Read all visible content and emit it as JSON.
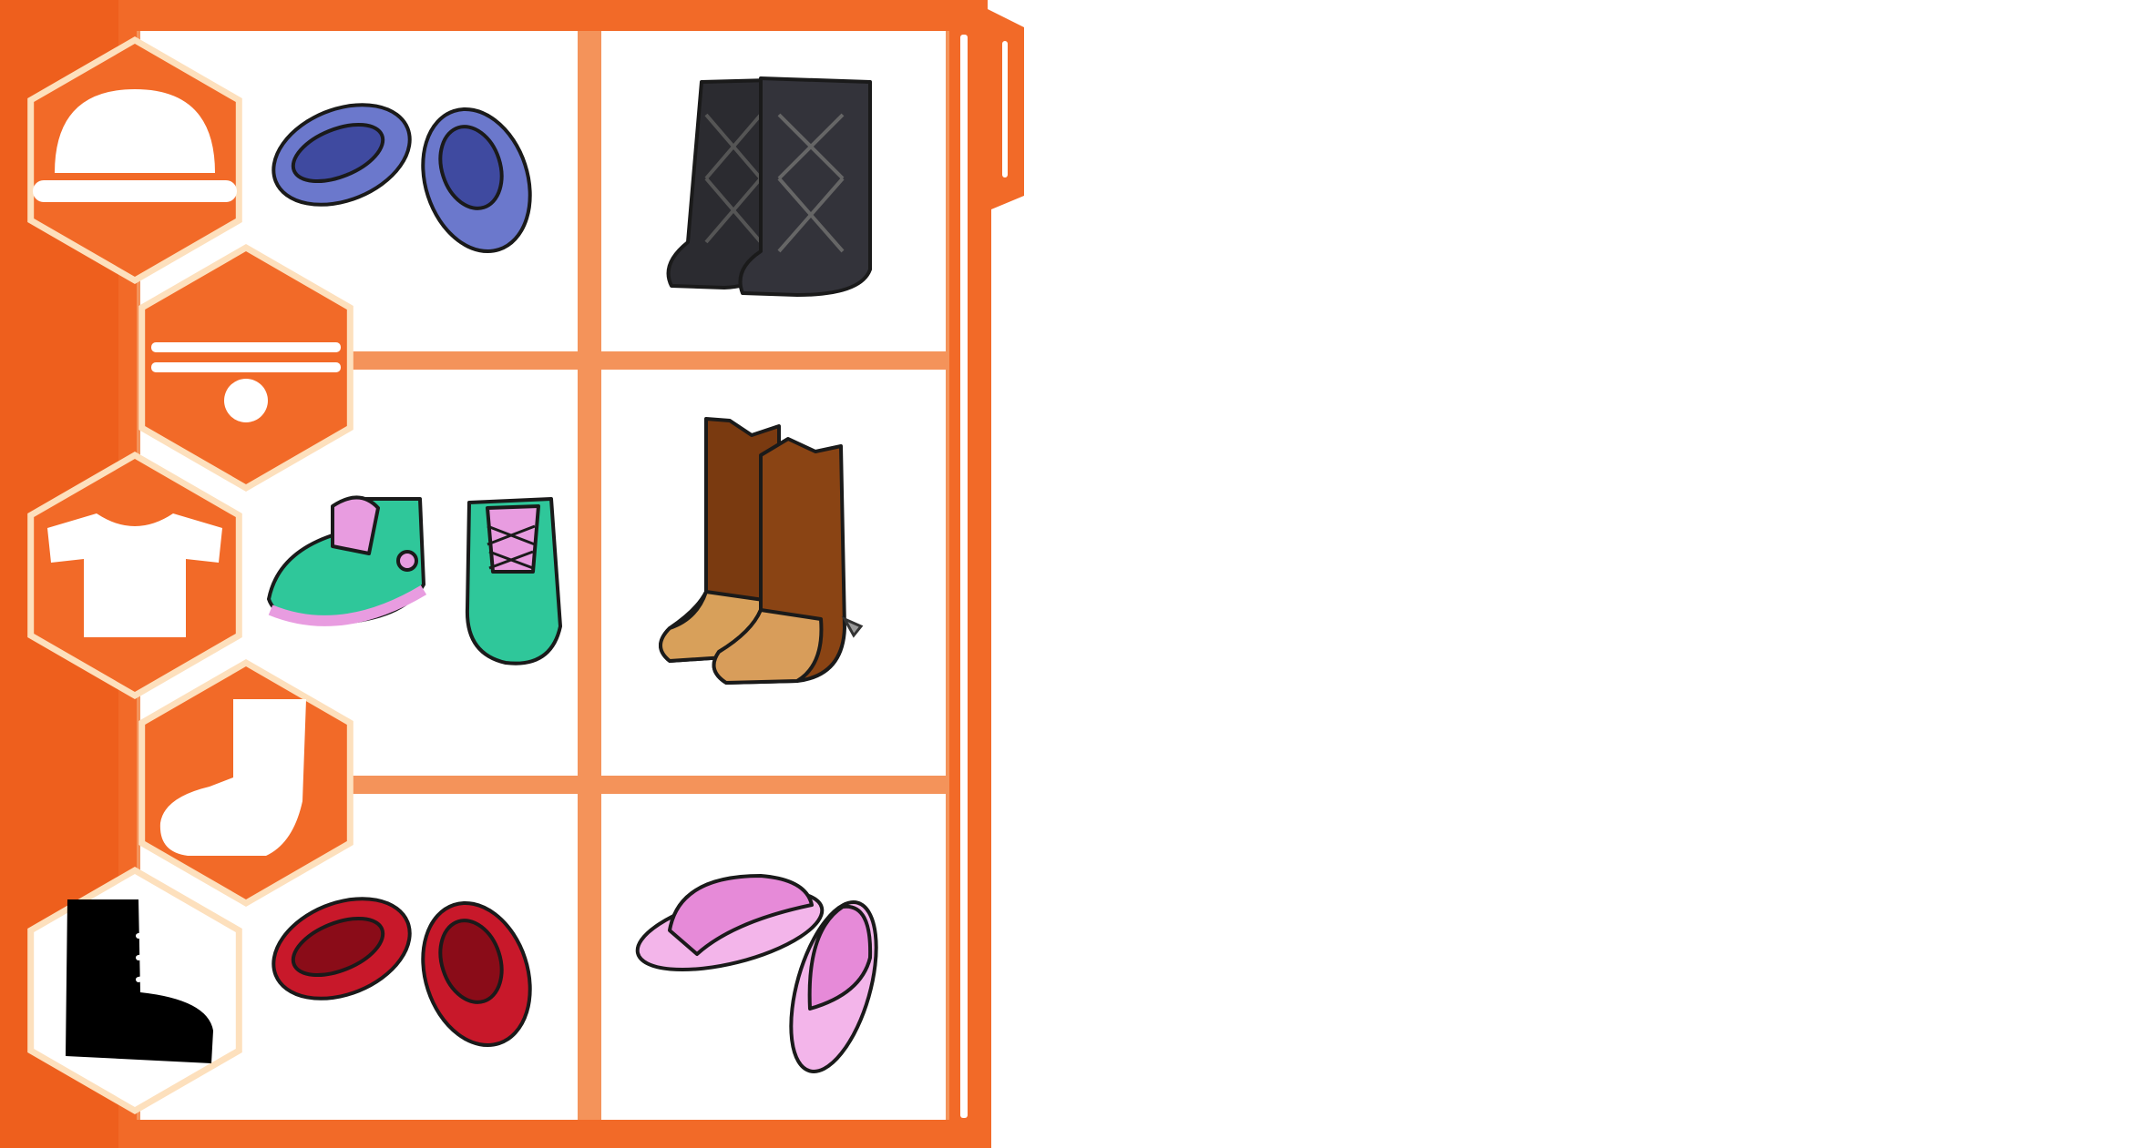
{
  "colors": {
    "frame": "#f26a28",
    "divider": "#f4935a",
    "hex_fill": "#f26a28",
    "hex_outline": "#fde0bd",
    "hex_selected_fill": "#ffffff",
    "icon_default": "#ffffff",
    "icon_selected": "#000000",
    "cell_bg": "#ffffff"
  },
  "categories": [
    {
      "id": "hats",
      "icon": "hat-icon",
      "selected": false
    },
    {
      "id": "accessories",
      "icon": "necklace-icon",
      "selected": false
    },
    {
      "id": "tops",
      "icon": "tshirt-icon",
      "selected": false
    },
    {
      "id": "socks",
      "icon": "sock-icon",
      "selected": false
    },
    {
      "id": "shoes",
      "icon": "boot-icon",
      "selected": true
    }
  ],
  "items": [
    {
      "id": "blue-flats",
      "icon": "blue-flats-icon",
      "color": "#6b78cc",
      "dark": "#3f4aa0"
    },
    {
      "id": "black-boots",
      "icon": "black-boots-icon",
      "color": "#2b2b30",
      "dark": "#101012"
    },
    {
      "id": "green-sneakers",
      "icon": "green-sneakers-icon",
      "color": "#2fc79a",
      "dark": "#e89ce0"
    },
    {
      "id": "cowboy-boots",
      "icon": "cowboy-boots-icon",
      "color": "#7a3a10",
      "dark": "#d8a05a"
    },
    {
      "id": "red-flats",
      "icon": "red-flats-icon",
      "color": "#c8182a",
      "dark": "#8a0c18"
    },
    {
      "id": "pink-slippers",
      "icon": "pink-slippers-icon",
      "color": "#e68ad8",
      "dark": "#f3b5ea"
    }
  ]
}
